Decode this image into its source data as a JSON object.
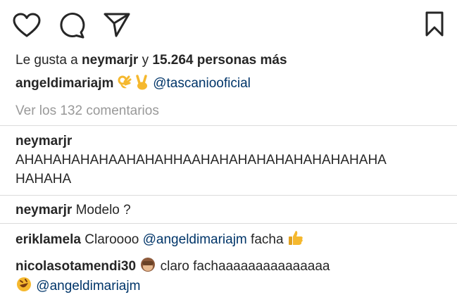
{
  "likes": {
    "prefix": "Le gusta a",
    "user": "neymarjr",
    "connector": "y",
    "count_text": "15.264 personas más"
  },
  "caption": {
    "username": "angeldimariajm",
    "emojis": [
      "ok-hand-emoji",
      "victory-hand-emoji"
    ],
    "mention": "@tascaniooficial"
  },
  "view_comments": "Ver los 132 comentarios",
  "comments": [
    {
      "username": "neymarjr",
      "line1": "AHAHAHAHAHAAHAHAHHAAHAHAHAHAHAHAHAHAHAHA",
      "line2": "HAHAHA"
    },
    {
      "username": "neymarjr",
      "text": "Modelo ?"
    },
    {
      "username": "eriklamela",
      "text": "Claroooo",
      "mention": "@angeldimariajm",
      "text_after": "facha",
      "emoji": "thumbs-up-emoji"
    },
    {
      "username": "nicolasotamendi30",
      "emoji": "see-no-evil-monkey-emoji",
      "text": "claro fachaaaaaaaaaaaaaaa",
      "emoji2": "rofl-emoji",
      "mention": "@angeldimariajm"
    }
  ],
  "icons": [
    "heart-icon",
    "comment-icon",
    "share-icon",
    "bookmark-icon"
  ],
  "colors": {
    "text": "#262626",
    "link": "#003569",
    "muted": "#999999",
    "emoji": "#f5b82e"
  }
}
